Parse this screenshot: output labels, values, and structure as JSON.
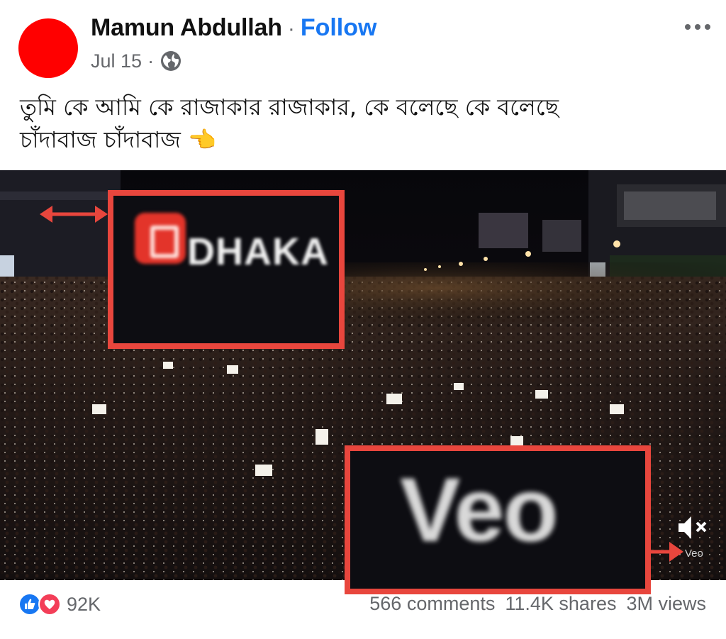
{
  "post": {
    "author": "Mamun Abdullah",
    "separator": "·",
    "follow_label": "Follow",
    "date": "Jul 15",
    "date_separator": "·",
    "privacy_icon": "globe-icon",
    "more_icon": "more-options-icon",
    "text_line1": "তুমি কে আমি কে রাজাকার রাজাকার, কে বলেছে কে বলেছে",
    "text_line2": "চাঁদাবাজ চাঁদাবাজ",
    "text_emoji": "👈"
  },
  "media": {
    "zoom_dhaka_text": "DHAKA",
    "zoom_veo_text": "Veo",
    "watermark_small": "Veo",
    "mute_icon": "speaker-muted-icon"
  },
  "footer": {
    "reaction_count": "92K",
    "comments": "566 comments",
    "shares": "11.4K shares",
    "views": "3M views"
  },
  "colors": {
    "accent": "#1877f2",
    "highlight": "#e8463d",
    "avatar": "#ff0000"
  }
}
